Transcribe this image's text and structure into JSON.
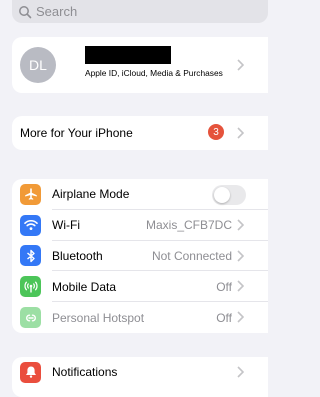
{
  "search": {
    "placeholder": "Search"
  },
  "profile": {
    "initials": "DL",
    "subtitle": "Apple ID, iCloud, Media & Purchases"
  },
  "more": {
    "label": "More for Your iPhone",
    "badge": "3"
  },
  "connectivity": [
    {
      "label": "Airplane Mode",
      "value": "",
      "icon": "airplane-icon",
      "color": "#f19a37"
    },
    {
      "label": "Wi-Fi",
      "value": "Maxis_CFB7DC",
      "icon": "wifi-icon",
      "color": "#3478f6"
    },
    {
      "label": "Bluetooth",
      "value": "Not Connected",
      "icon": "bluetooth-icon",
      "color": "#3478f6"
    },
    {
      "label": "Mobile Data",
      "value": "Off",
      "icon": "antenna-icon",
      "color": "#4cc559"
    },
    {
      "label": "Personal Hotspot",
      "value": "Off",
      "icon": "hotspot-icon",
      "color": "#4cc559"
    }
  ],
  "airplane_mode_on": false,
  "notifications": {
    "label": "Notifications",
    "icon": "bell-icon",
    "color": "#ea4e3d"
  }
}
